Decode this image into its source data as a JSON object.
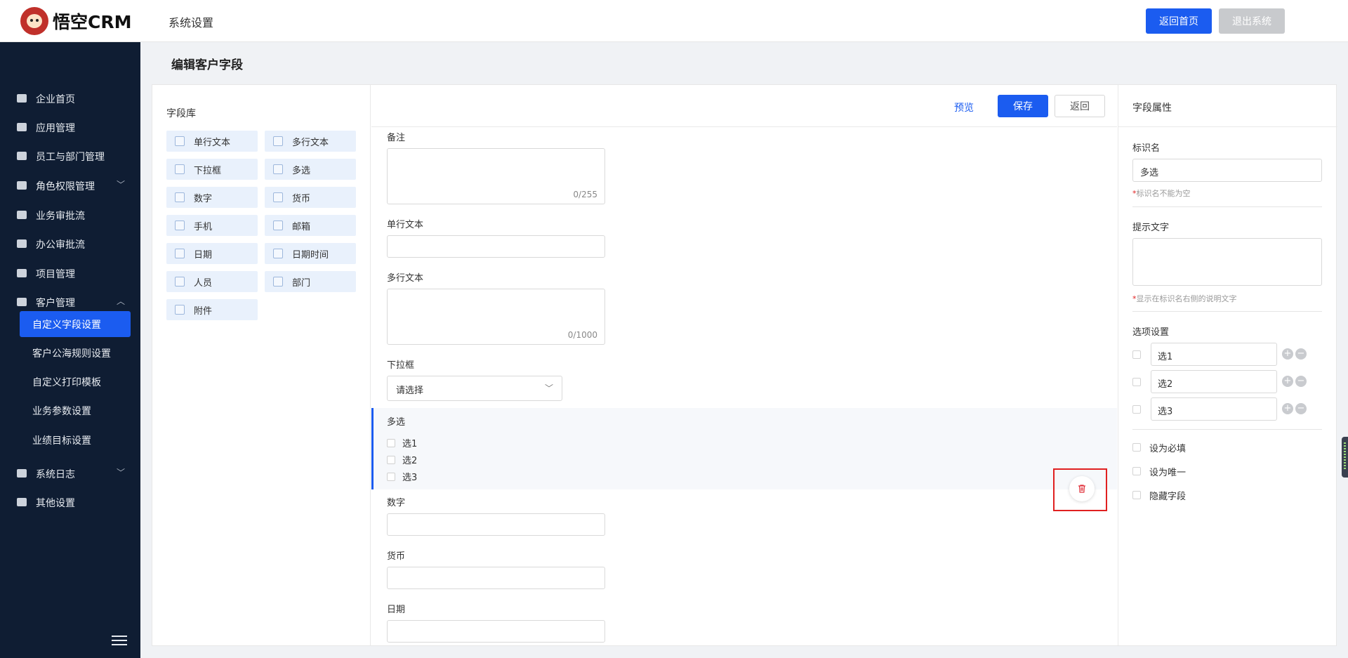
{
  "brand": {
    "logo_text": "悟空CRM"
  },
  "header": {
    "section_title": "系统设置",
    "home_button": "返回首页",
    "logout_button": "退出系统"
  },
  "sidebar": {
    "items": [
      {
        "label": "企业首页",
        "icon": "home-icon"
      },
      {
        "label": "应用管理",
        "icon": "apps-icon"
      },
      {
        "label": "员工与部门管理",
        "icon": "users-icon"
      },
      {
        "label": "角色权限管理",
        "icon": "user-role-icon",
        "expandable": true
      },
      {
        "label": "业务审批流",
        "icon": "user-icon"
      },
      {
        "label": "办公审批流",
        "icon": "user-icon"
      },
      {
        "label": "项目管理",
        "icon": "list-icon"
      },
      {
        "label": "客户管理",
        "icon": "building-icon",
        "expanded": true
      }
    ],
    "sub_items": [
      "自定义字段设置",
      "客户公海规则设置",
      "自定义打印模板",
      "业务参数设置",
      "业绩目标设置"
    ],
    "bottom_items": [
      {
        "label": "系统日志",
        "icon": "log-icon",
        "expandable": true
      },
      {
        "label": "其他设置",
        "icon": "gear-icon"
      }
    ],
    "active_sub": "自定义字段设置"
  },
  "page": {
    "title": "编辑客户字段"
  },
  "field_library": {
    "title": "字段库",
    "items": [
      "单行文本",
      "多行文本",
      "下拉框",
      "多选",
      "数字",
      "货币",
      "手机",
      "邮箱",
      "日期",
      "日期时间",
      "人员",
      "部门",
      "附件"
    ]
  },
  "toolbar": {
    "preview": "预览",
    "save": "保存",
    "back": "返回"
  },
  "form": {
    "remark_label": "备注",
    "remark_count": "0/255",
    "single_text_label": "单行文本",
    "multi_text_label": "多行文本",
    "multi_text_count": "0/1000",
    "dropdown_label": "下拉框",
    "dropdown_placeholder": "请选择",
    "multiselect_label": "多选",
    "multiselect_options": [
      "选1",
      "选2",
      "选3"
    ],
    "number_label": "数字",
    "currency_label": "货币",
    "date_label": "日期"
  },
  "properties": {
    "title": "字段属性",
    "name_label": "标识名",
    "name_value": "多选",
    "name_hint": "标识名不能为空",
    "hint_label": "提示文字",
    "hint_hint": "显示在标识名右侧的说明文字",
    "options_label": "选项设置",
    "options": [
      "选1",
      "选2",
      "选3"
    ],
    "required_label": "设为必填",
    "unique_label": "设为唯一",
    "hidden_label": "隐藏字段"
  },
  "colors": {
    "primary": "#1b5cf0",
    "sidebar_bg": "#0f1d33",
    "danger": "#e02020"
  }
}
